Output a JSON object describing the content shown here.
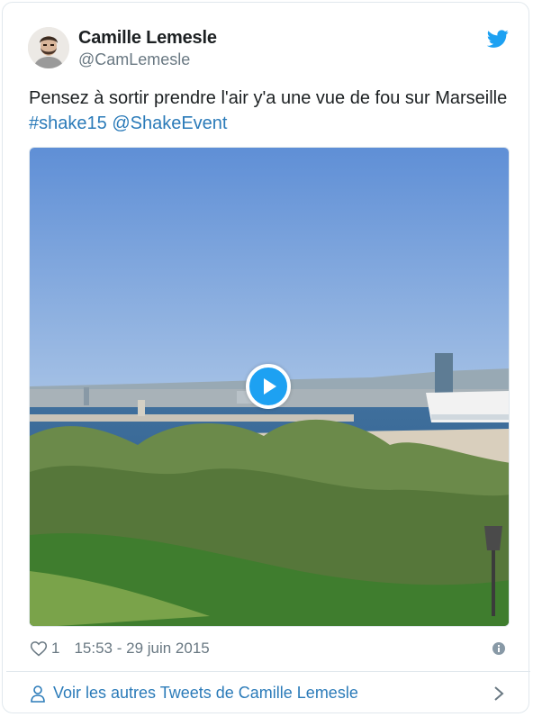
{
  "tweet": {
    "author_name": "Camille Lemesle",
    "author_handle": "@CamLemesle",
    "text": "Pensez à sortir prendre l'air y'a une vue de fou sur Marseille",
    "hashtag": "#shake15",
    "mention": "@ShakeEvent",
    "like_count": "1",
    "timestamp": "15:53 - 29 juin 2015"
  },
  "footer": {
    "more_tweets_label": "Voir les autres Tweets de Camille Lemesle"
  },
  "colors": {
    "twitter_blue": "#1da1f2",
    "link": "#2b7bb9",
    "meta_gray": "#697882"
  },
  "icons": [
    "twitter-bird-icon",
    "play-icon",
    "heart-icon",
    "info-icon",
    "person-icon",
    "chevron-right-icon"
  ]
}
